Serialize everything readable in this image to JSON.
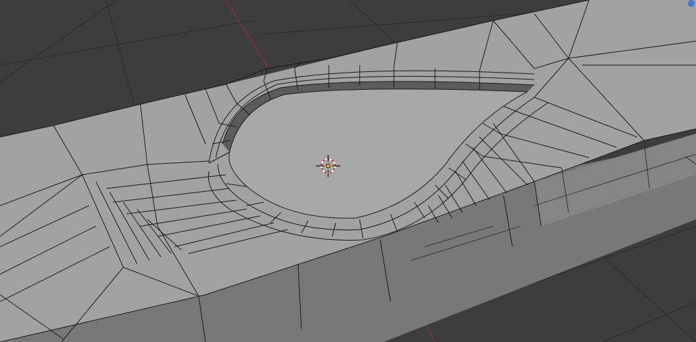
{
  "viewport": {
    "title": "",
    "colors": {
      "background": "#3d3d3d",
      "grid": "#2b2b2b",
      "top_face": "#a2a2a2",
      "recess_floor": "#a6a6a6",
      "front_face": "#787878",
      "side_face": "#848484",
      "wall_face": "#656565",
      "edge": "#1a1a1a",
      "x_axis": "#9a2a3c",
      "navigation_dot": "#3a7be0",
      "cursor_ring": "#c83232"
    },
    "icons": {
      "cursor": "3d-cursor-icon",
      "navigation": "navigation-gizmo-icon"
    }
  }
}
